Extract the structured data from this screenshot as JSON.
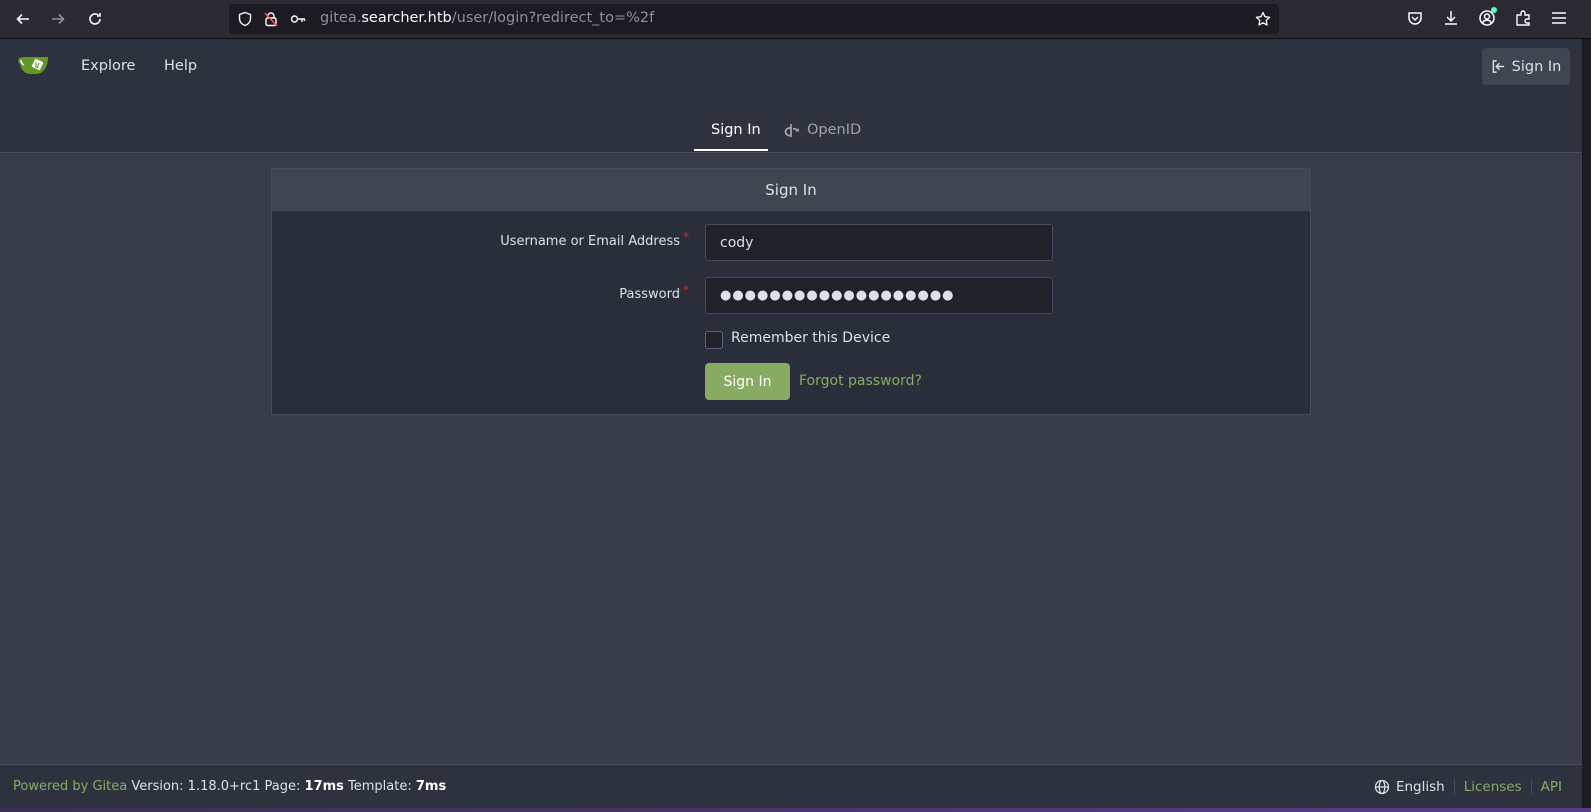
{
  "browser": {
    "url_prefix": "gitea.",
    "url_domain": "searcher.htb",
    "url_path": "/user/login?redirect_to=%2f"
  },
  "header": {
    "explore": "Explore",
    "help": "Help",
    "sign_in": "Sign In"
  },
  "tabs": {
    "sign_in": "Sign In",
    "openid": "OpenID"
  },
  "form": {
    "title": "Sign In",
    "username_label": "Username or Email Address",
    "username_value": "cody",
    "password_label": "Password",
    "password_value": "●●●●●●●●●●●●●●●●●●●",
    "required_mark": "*",
    "remember_label": "Remember this Device",
    "submit_label": "Sign In",
    "forgot_label": "Forgot password?"
  },
  "footer": {
    "powered_by": "Powered by Gitea",
    "version": " Version: 1.18.0+rc1 Page: ",
    "page_time": "17ms",
    "template_label": " Template: ",
    "template_time": "7ms",
    "language": "English",
    "licenses": "Licenses",
    "api": "API"
  },
  "colors": {
    "accent_green": "#87ab63",
    "page_bg": "#383c4a",
    "nav_bg": "#2e323e"
  }
}
